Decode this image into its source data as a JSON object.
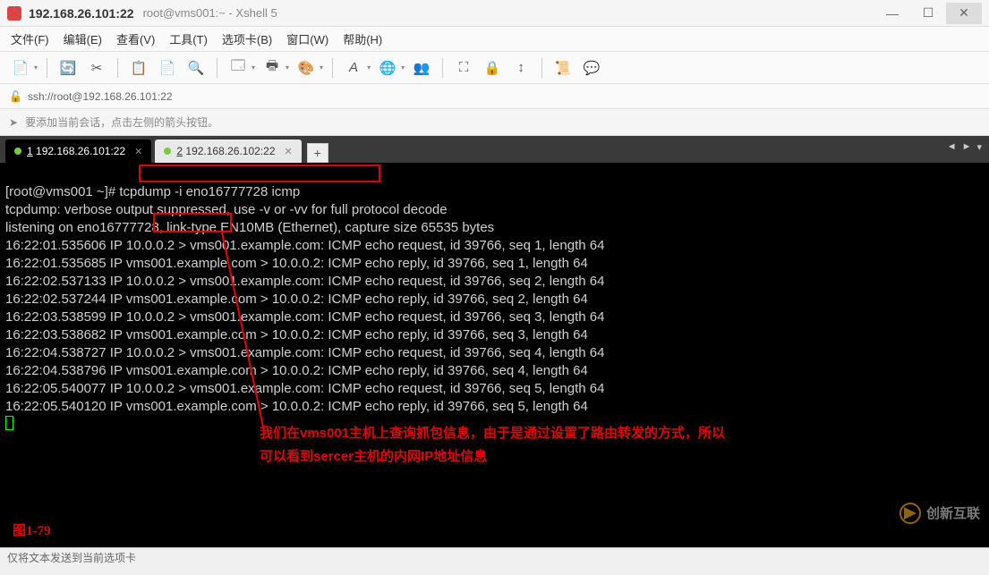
{
  "window": {
    "title": "192.168.26.101:22",
    "subtitle": "root@vms001:~ - Xshell 5"
  },
  "menu": {
    "file": "文件(F)",
    "edit": "编辑(E)",
    "view": "查看(V)",
    "tools": "工具(T)",
    "tabs": "选项卡(B)",
    "window": "窗口(W)",
    "help": "帮助(H)"
  },
  "address": {
    "url": "ssh://root@192.168.26.101:22"
  },
  "hint": {
    "text": "要添加当前会话，点击左侧的箭头按钮。"
  },
  "tabs": {
    "t1": "192.168.26.101:22",
    "t2": "192.168.26.102:22",
    "add": "+"
  },
  "terminal": {
    "prompt": "[root@vms001 ~]# ",
    "command": "tcpdump -i eno16777728 icmp",
    "line_verbose": "tcpdump: verbose output suppressed, use -v or -vv for full protocol decode",
    "line_listen": "listening on eno16777728, link-type EN10MB (Ethernet), capture size 65535 bytes",
    "l1": "16:22:01.535606 IP 10.0.0.2 > vms001.example.com: ICMP echo request, id 39766, seq 1, length 64",
    "l2": "16:22:01.535685 IP vms001.example.com > 10.0.0.2: ICMP echo reply, id 39766, seq 1, length 64",
    "l3": "16:22:02.537133 IP 10.0.0.2 > vms001.example.com: ICMP echo request, id 39766, seq 2, length 64",
    "l4": "16:22:02.537244 IP vms001.example.com > 10.0.0.2: ICMP echo reply, id 39766, seq 2, length 64",
    "l5": "16:22:03.538599 IP 10.0.0.2 > vms001.example.com: ICMP echo request, id 39766, seq 3, length 64",
    "l6": "16:22:03.538682 IP vms001.example.com > 10.0.0.2: ICMP echo reply, id 39766, seq 3, length 64",
    "l7": "16:22:04.538727 IP 10.0.0.2 > vms001.example.com: ICMP echo request, id 39766, seq 4, length 64",
    "l8": "16:22:04.538796 IP vms001.example.com > 10.0.0.2: ICMP echo reply, id 39766, seq 4, length 64",
    "l9": "16:22:05.540077 IP 10.0.0.2 > vms001.example.com: ICMP echo request, id 39766, seq 5, length 64",
    "l10": "16:22:05.540120 IP vms001.example.com > 10.0.0.2: ICMP echo reply, id 39766, seq 5, length 64"
  },
  "annotation": {
    "line1": "我们在vms001主机上查询抓包信息，由于是通过设置了路由转发的方式，所以",
    "line2": "可以看到sercer主机的内网IP地址信息",
    "figure": "图1-79"
  },
  "watermark": {
    "text": "创新互联"
  },
  "status": {
    "text": "仅将文本发送到当前选项卡"
  }
}
